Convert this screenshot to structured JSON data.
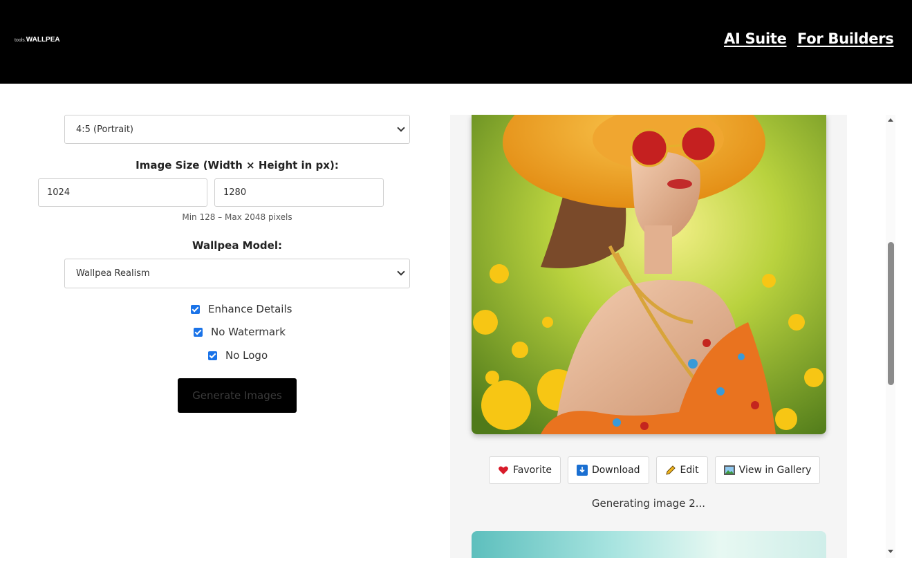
{
  "header": {
    "brand_prefix": "tools.",
    "brand_name": "WALLPEA",
    "nav": [
      {
        "label": "AI Suite"
      },
      {
        "label": "For Builders"
      }
    ]
  },
  "form": {
    "aspect_ratio_value": "4:5 (Portrait)",
    "size_label": "Image Size (Width × Height in px):",
    "width_value": "1024",
    "height_value": "1280",
    "size_hint": "Min 128 – Max 2048 pixels",
    "model_label": "Wallpea Model:",
    "model_value": "Wallpea Realism",
    "options": [
      {
        "label": "Enhance Details",
        "checked": true
      },
      {
        "label": "No Watermark",
        "checked": true
      },
      {
        "label": "No Logo",
        "checked": true
      }
    ],
    "generate_label": "Generate Images"
  },
  "result": {
    "actions": [
      {
        "label": "Favorite",
        "icon": "heart-icon"
      },
      {
        "label": "Download",
        "icon": "download-icon"
      },
      {
        "label": "Edit",
        "icon": "pencil-icon"
      },
      {
        "label": "View in Gallery",
        "icon": "picture-icon"
      }
    ],
    "status": "Generating image 2..."
  },
  "colors": {
    "header_bg": "#000000",
    "checkbox": "#1a73e8",
    "panel_bg": "#f5f5f5"
  }
}
